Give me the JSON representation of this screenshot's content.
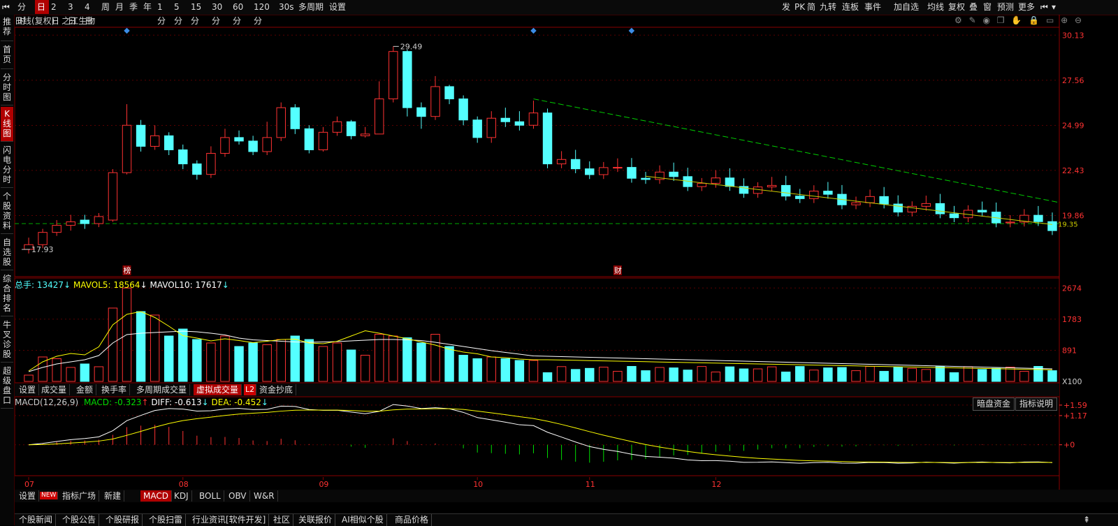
{
  "toolbar": {
    "left": [
      "分时",
      "日",
      "2日",
      "3日",
      "4日",
      "周",
      "月",
      "季",
      "年",
      "1分",
      "5分",
      "15分",
      "30分",
      "60分",
      "120分",
      "30s",
      "多周期",
      "设置"
    ],
    "right": [
      "发",
      "PK",
      "简",
      "九转",
      "连板",
      "事件",
      "加自选",
      "均线",
      "复权",
      "叠",
      "窗",
      "预测",
      "更多"
    ]
  },
  "sidebar": {
    "items": [
      "推荐",
      "首页",
      "分时图",
      "K线图",
      "闪电分时",
      "个股资料",
      "自选股",
      "综合排名",
      "牛叉诊股",
      "超级盘口"
    ]
  },
  "header": {
    "period": "日线(复权)",
    "stock": "之江生物"
  },
  "markers": {
    "bang": "榜",
    "cai": "财"
  },
  "volume_legend": {
    "total_label": "总手:",
    "total": "13427",
    "mavol5_label": "MAVOL5:",
    "mavol5": "18564",
    "mavol10_label": "MAVOL10:",
    "mavol10": "17617"
  },
  "mid_tabs": [
    "设置",
    "成交量",
    "金额",
    "换手率",
    "多周期成交量",
    "虚拟成交量",
    "L2",
    "资金抄底"
  ],
  "macd_legend": {
    "name": "MACD(12,26,9)",
    "macd_label": "MACD:",
    "macd": "-0.323",
    "diff_label": "DIFF:",
    "diff": "-0.613",
    "dea_label": "DEA:",
    "dea": "-0.452"
  },
  "macd_buttons": [
    "暗盘资金",
    "指标说明"
  ],
  "bottom_tabs": [
    "设置",
    "NEW",
    "指标广场",
    "新建",
    "MACD",
    "KDJ",
    "BOLL",
    "OBV",
    "W&R"
  ],
  "news_tabs": [
    "个股新闻",
    "个股公告",
    "个股研报",
    "个股扫雷",
    "行业资讯[软件开发]",
    "社区",
    "关联报价",
    "AI相似个股",
    "商品价格"
  ],
  "colors": {
    "up": "#ff3232",
    "down": "#54ffff",
    "ma5": "#ffff00",
    "ma10": "#ffffff",
    "trend_upper": "#00cc00",
    "trend_lower": "#cccc00",
    "support": "#00aa00"
  },
  "chart_data": {
    "type": "candlestick",
    "price_axis": [
      "30.13",
      "27.56",
      "24.99",
      "22.43",
      "19.86"
    ],
    "price_range": [
      16.5,
      30.5
    ],
    "high_label": "29.49",
    "low_label": "17.93",
    "last_label": "19.35",
    "support_level": 19.4,
    "volume_axis": [
      "2674",
      "1783",
      "891",
      "X100"
    ],
    "volume_range": [
      0,
      2800
    ],
    "macd_axis": [
      "+1.59",
      "+1.17",
      "+0"
    ],
    "macd_range": [
      -1.1,
      1.7
    ],
    "x_labels": [
      "07",
      "08",
      "09",
      "10",
      "11",
      "12"
    ],
    "x_label_index": [
      0,
      11,
      21,
      32,
      40,
      49
    ],
    "candles": [
      [
        17.93,
        18.2,
        17.7,
        18.6,
        180
      ],
      [
        18.2,
        18.9,
        18.0,
        19.1,
        700
      ],
      [
        18.9,
        19.3,
        18.7,
        19.6,
        650
      ],
      [
        19.3,
        19.5,
        19.0,
        19.9,
        400
      ],
      [
        19.6,
        19.4,
        19.1,
        19.9,
        500
      ],
      [
        19.4,
        19.8,
        19.2,
        20.0,
        420
      ],
      [
        19.6,
        22.3,
        19.5,
        22.5,
        2100
      ],
      [
        22.3,
        25.0,
        22.2,
        26.2,
        2674
      ],
      [
        25.0,
        23.8,
        23.5,
        25.3,
        2000
      ],
      [
        23.8,
        24.4,
        23.6,
        25.0,
        1900
      ],
      [
        24.4,
        23.6,
        23.3,
        24.6,
        1300
      ],
      [
        23.6,
        22.8,
        22.5,
        23.9,
        1500
      ],
      [
        22.8,
        22.2,
        21.9,
        23.0,
        1200
      ],
      [
        22.2,
        23.4,
        22.0,
        23.8,
        1100
      ],
      [
        23.4,
        24.3,
        23.2,
        24.8,
        1300
      ],
      [
        24.3,
        24.1,
        23.9,
        24.7,
        1000
      ],
      [
        24.1,
        23.5,
        23.3,
        24.4,
        1100
      ],
      [
        23.5,
        24.3,
        23.3,
        25.2,
        1050
      ],
      [
        24.3,
        26.0,
        24.1,
        26.3,
        1200
      ],
      [
        26.0,
        24.8,
        24.5,
        26.2,
        1300
      ],
      [
        24.8,
        23.6,
        23.4,
        25.0,
        1200
      ],
      [
        23.6,
        24.6,
        23.5,
        24.9,
        1000
      ],
      [
        24.6,
        25.2,
        24.4,
        25.5,
        1100
      ],
      [
        25.2,
        24.4,
        24.2,
        25.3,
        900
      ],
      [
        24.4,
        24.5,
        24.3,
        24.9,
        750
      ],
      [
        24.5,
        26.5,
        24.5,
        27.5,
        1350
      ],
      [
        26.5,
        29.2,
        26.3,
        29.49,
        1300
      ],
      [
        29.2,
        26.0,
        25.5,
        29.3,
        1250
      ],
      [
        26.0,
        25.5,
        24.8,
        26.3,
        1100
      ],
      [
        25.5,
        27.2,
        25.3,
        27.8,
        1350
      ],
      [
        27.2,
        26.5,
        26.2,
        27.3,
        1000
      ],
      [
        26.5,
        25.3,
        25.0,
        26.7,
        750
      ],
      [
        25.3,
        24.3,
        24.0,
        25.5,
        650
      ],
      [
        24.3,
        25.4,
        24.0,
        25.8,
        700
      ],
      [
        25.4,
        25.2,
        24.9,
        26.0,
        650
      ],
      [
        25.2,
        25.0,
        24.7,
        25.8,
        600
      ],
      [
        25.0,
        25.7,
        24.8,
        26.4,
        600
      ]
    ],
    "downtrend_candles": 37,
    "downtrend_start": 22.8,
    "downtrend_end": 19.35,
    "ma5": [
      300,
      560,
      720,
      800,
      760,
      990,
      1620,
      1920,
      2000,
      1830,
      1580,
      1310,
      1240,
      1160,
      1220,
      1170,
      1110,
      1150,
      1200,
      1210,
      1100,
      1080,
      1150,
      1300,
      1450,
      1380,
      1300,
      1220,
      1130,
      1040,
      920,
      840,
      790,
      700,
      680,
      640,
      620
    ],
    "ma10": [
      280,
      400,
      500,
      560,
      620,
      740,
      1100,
      1340,
      1380,
      1400,
      1420,
      1440,
      1420,
      1380,
      1330,
      1240,
      1190,
      1170,
      1150,
      1130,
      1120,
      1130,
      1140,
      1160,
      1180,
      1200,
      1200,
      1190,
      1170,
      1120,
      1060,
      1000,
      940,
      880,
      830,
      780,
      730
    ]
  }
}
